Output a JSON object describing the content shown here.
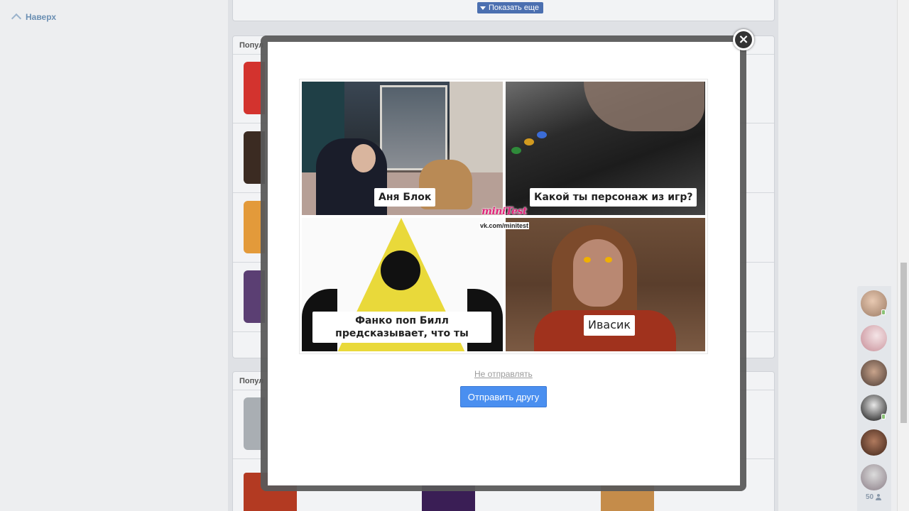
{
  "nav": {
    "to_top_label": "Наверх"
  },
  "background": {
    "show_more_label": "Показать еще",
    "section1_title": "Попул",
    "section2_title": "Попул"
  },
  "modal": {
    "tiles": [
      {
        "label": "Аня Блок"
      },
      {
        "label": "Какой ты персонаж из игр?"
      },
      {
        "label": "Фанко поп Билл предсказывает, что ты"
      },
      {
        "label": "Ивасик"
      }
    ],
    "watermark": {
      "logo": "miniTest",
      "url": "vk.com/minitest"
    },
    "no_send_label": "Не отправлять",
    "send_button_label": "Отправить другу",
    "close_icon": "close-icon"
  },
  "friends_panel": {
    "count": "50"
  },
  "colors": {
    "accent": "#4a8ff0",
    "link": "#6b8fb3",
    "online": "#8ac176"
  }
}
